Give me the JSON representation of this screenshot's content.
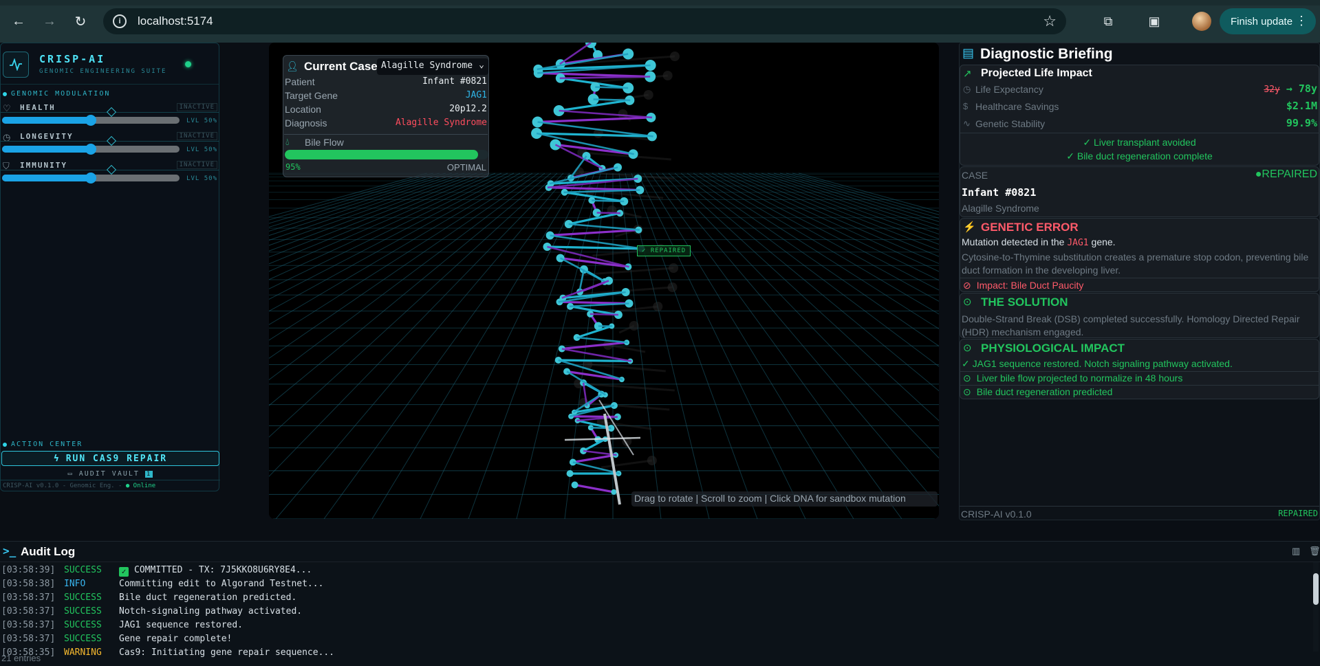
{
  "browser": {
    "url": "localhost:5174",
    "finish_update_label": "Finish update",
    "icons": [
      "back-arrow-icon",
      "forward-arrow-icon",
      "reload-icon",
      "site-info-icon",
      "bookmark-star-icon",
      "extensions-icon",
      "cast-icon",
      "profile-avatar",
      "more-menu-icon"
    ]
  },
  "sidebar": {
    "brand_name": "CRISP-AI",
    "brand_sub": "GENOMIC ENGINEERING SUITE",
    "modulation_title": "GENOMIC MODULATION",
    "modules": [
      {
        "label": "HEALTH",
        "state": "INACTIVE",
        "level": "LVL 50%",
        "icon": "heart-icon",
        "value": 0.5
      },
      {
        "label": "LONGEVITY",
        "state": "INACTIVE",
        "level": "LVL 50%",
        "icon": "clock-icon",
        "value": 0.5
      },
      {
        "label": "IMMUNITY",
        "state": "INACTIVE",
        "level": "LVL 50%",
        "icon": "shield-icon",
        "value": 0.5
      }
    ],
    "action_title": "ACTION CENTER",
    "run_label": "RUN CAS9 REPAIR",
    "vault_label": "AUDIT VAULT",
    "vault_badge": "1",
    "version_text": "CRISP-AI v0.1.0 - Genomic Eng. -",
    "online_text": "● Online"
  },
  "case": {
    "title": "Current Case",
    "selected": "Alagille Syndrome",
    "rows": [
      {
        "key": "Patient",
        "value": "Infant #0821",
        "color": "white"
      },
      {
        "key": "Target Gene",
        "value": "JAG1",
        "color": "blue"
      },
      {
        "key": "Location",
        "value": "20p12.2",
        "color": "white"
      },
      {
        "key": "Diagnosis",
        "value": "Alagille Syndrome",
        "color": "red"
      }
    ],
    "bile_label": "Bile Flow",
    "bile_pct_text": "95%",
    "bile_value": 0.95,
    "bile_status": "OPTIMAL"
  },
  "viewport": {
    "repaired_tag": "✓ REPAIRED",
    "hint": "Drag to rotate | Scroll to zoom | Click DNA for sandbox mutation"
  },
  "briefing": {
    "title": "Diagnostic Briefing",
    "impact_title": "Projected Life Impact",
    "metrics": [
      {
        "label": "Life Expectancy",
        "old": "32y",
        "arrow": "→",
        "value": "78y",
        "icon": "clock-icon"
      },
      {
        "label": "Healthcare Savings",
        "value": "$2.1M",
        "icon": "dollar-icon"
      },
      {
        "label": "Genetic Stability",
        "value": "99.9%",
        "icon": "pulse-icon"
      }
    ],
    "checks": [
      "✓ Liver transplant avoided",
      "✓ Bile duct regeneration complete"
    ],
    "case_label": "CASE",
    "case_status": "●REPAIRED",
    "case_id": "Infant #0821",
    "case_disease": "Alagille Syndrome",
    "error_title": "GENETIC ERROR",
    "error_pre": "Mutation detected in the ",
    "error_gene": "JAG1",
    "error_post": " gene.",
    "error_desc": "Cytosine-to-Thymine substitution creates a premature stop codon, preventing bile duct formation in the developing liver.",
    "error_impact": "Impact: Bile Duct Paucity",
    "solution_title": "THE SOLUTION",
    "solution_desc": "Double-Strand Break (DSB) completed successfully. Homology Directed Repair (HDR) mechanism engaged.",
    "phys_title": "PHYSIOLOGICAL IMPACT",
    "phys_line": "✓ JAG1 sequence restored. Notch signaling pathway activated.",
    "phys_items": [
      "Liver bile flow projected to normalize in 48 hours",
      "Bile duct regeneration predicted"
    ],
    "footer_version": "CRISP-AI v0.1.0",
    "footer_status": "REPAIRED"
  },
  "audit": {
    "title": "Audit Log",
    "entries_text": "21 entries",
    "logs": [
      {
        "ts": "[03:58:39]",
        "level": "SUCCESS",
        "msg": "COMMITTED - TX: 7J5KKO8U6RY8E4...",
        "icon": true
      },
      {
        "ts": "[03:58:38]",
        "level": "INFO",
        "msg": "Committing edit to Algorand Testnet..."
      },
      {
        "ts": "[03:58:37]",
        "level": "SUCCESS",
        "msg": "Bile duct regeneration predicted."
      },
      {
        "ts": "[03:58:37]",
        "level": "SUCCESS",
        "msg": "Notch-signaling pathway activated."
      },
      {
        "ts": "[03:58:37]",
        "level": "SUCCESS",
        "msg": "JAG1 sequence restored."
      },
      {
        "ts": "[03:58:37]",
        "level": "SUCCESS",
        "msg": "Gene repair complete!"
      },
      {
        "ts": "[03:58:35]",
        "level": "WARNING",
        "msg": "Cas9: Initiating gene repair sequence..."
      }
    ]
  }
}
